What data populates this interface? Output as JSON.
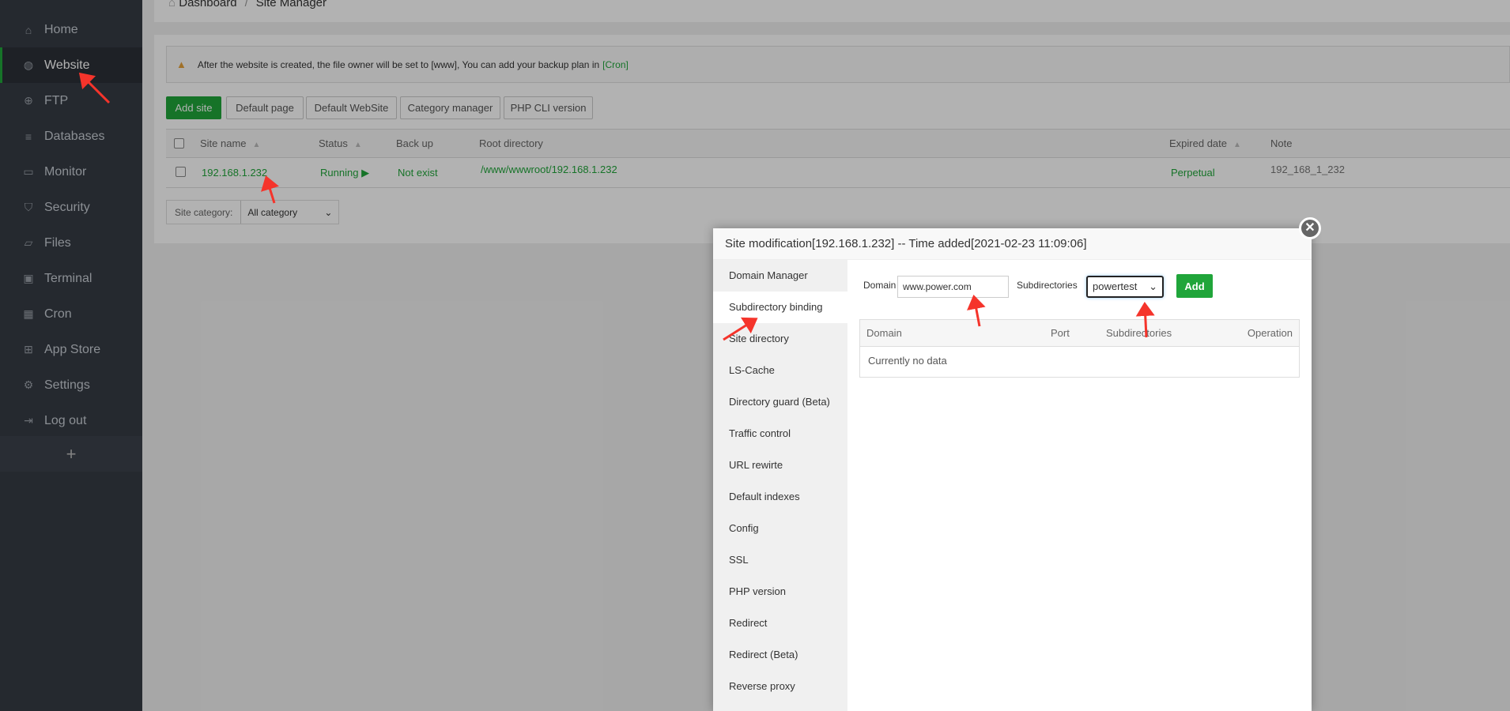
{
  "sidebar": {
    "items": [
      {
        "label": "Home",
        "icon": "home-icon"
      },
      {
        "label": "Website",
        "icon": "globe-icon",
        "active": true
      },
      {
        "label": "FTP",
        "icon": "ftp-icon"
      },
      {
        "label": "Databases",
        "icon": "database-icon"
      },
      {
        "label": "Monitor",
        "icon": "monitor-icon"
      },
      {
        "label": "Security",
        "icon": "shield-icon"
      },
      {
        "label": "Files",
        "icon": "folder-icon"
      },
      {
        "label": "Terminal",
        "icon": "terminal-icon"
      },
      {
        "label": "Cron",
        "icon": "calendar-icon"
      },
      {
        "label": "App Store",
        "icon": "grid-icon"
      },
      {
        "label": "Settings",
        "icon": "gear-icon"
      },
      {
        "label": "Log out",
        "icon": "logout-icon"
      }
    ],
    "add": "+"
  },
  "breadcrumb": {
    "home": "Dashboard",
    "sep": "/",
    "current": "Site Manager"
  },
  "alert": {
    "text": "After the website is created, the file owner will be set to [www], You can add your backup plan in",
    "link": "[Cron]"
  },
  "toolbar": {
    "add_site": "Add site",
    "default_page": "Default page",
    "default_website": "Default WebSite",
    "category_manager": "Category manager",
    "php_cli": "PHP CLI version"
  },
  "table": {
    "headers": {
      "site_name": "Site name",
      "status": "Status",
      "backup": "Back up",
      "root": "Root directory",
      "expired": "Expired date",
      "note": "Note"
    },
    "rows": [
      {
        "site_name": "192.168.1.232",
        "status": "Running",
        "backup": "Not exist",
        "root": "/www/wwwroot/192.168.1.232",
        "expired": "Perpetual",
        "note": "192_168_1_232"
      }
    ]
  },
  "category": {
    "label": "Site category:",
    "value": "All category"
  },
  "dialog": {
    "title": "Site modification[192.168.1.232] -- Time added[2021-02-23 11:09:06]",
    "nav": [
      "Domain Manager",
      "Subdirectory binding",
      "Site directory",
      "LS-Cache",
      "Directory guard (Beta)",
      "Traffic control",
      "URL rewirte",
      "Default indexes",
      "Config",
      "SSL",
      "PHP version",
      "Redirect",
      "Redirect (Beta)",
      "Reverse proxy"
    ],
    "domain_label": "Domain",
    "domain_value": "www.power.com",
    "subdir_label": "Subdirectories",
    "subdir_value": "powertest",
    "add": "Add",
    "table_headers": {
      "domain": "Domain",
      "port": "Port",
      "subdirs": "Subdirectories",
      "operation": "Operation"
    },
    "empty": "Currently no data",
    "close": "✕"
  },
  "colors": {
    "accent": "#20a53a",
    "sidebar": "#353b44",
    "annotation": "#f5342b"
  }
}
